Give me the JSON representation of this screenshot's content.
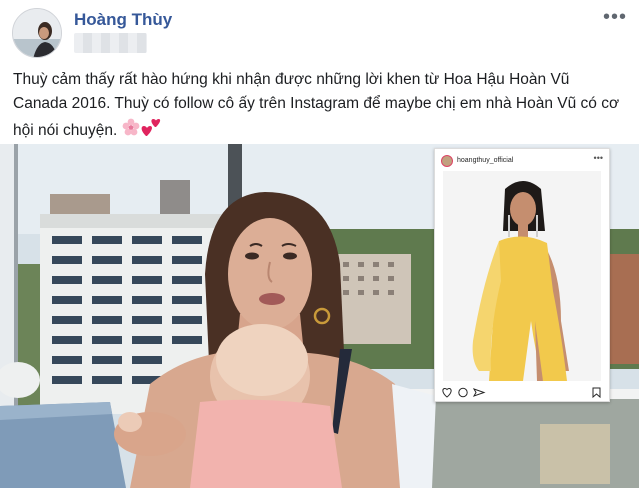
{
  "post": {
    "author": "Hoàng Thùy",
    "caption": "Thuỳ cảm thấy rất hào hứng khi nhận được những lời khen từ Hoa Hậu Hoàn Vũ Canada 2016. Thuỳ có follow cô ấy trên Instagram để maybe chị em nhà Hoàn Vũ có cơ hội nói chuyện.",
    "more_label": "•••"
  },
  "instagram": {
    "username": "hoangthuy_official",
    "more_label": "•••"
  },
  "icons": [
    "more-icon",
    "blossom-emoji",
    "heart-emoji",
    "ig-heart-icon",
    "ig-comment-icon",
    "ig-share-icon",
    "ig-bookmark-icon"
  ],
  "colors": {
    "author_link": "#365899",
    "text": "#1c1e21",
    "dress": "#f2c94c"
  }
}
